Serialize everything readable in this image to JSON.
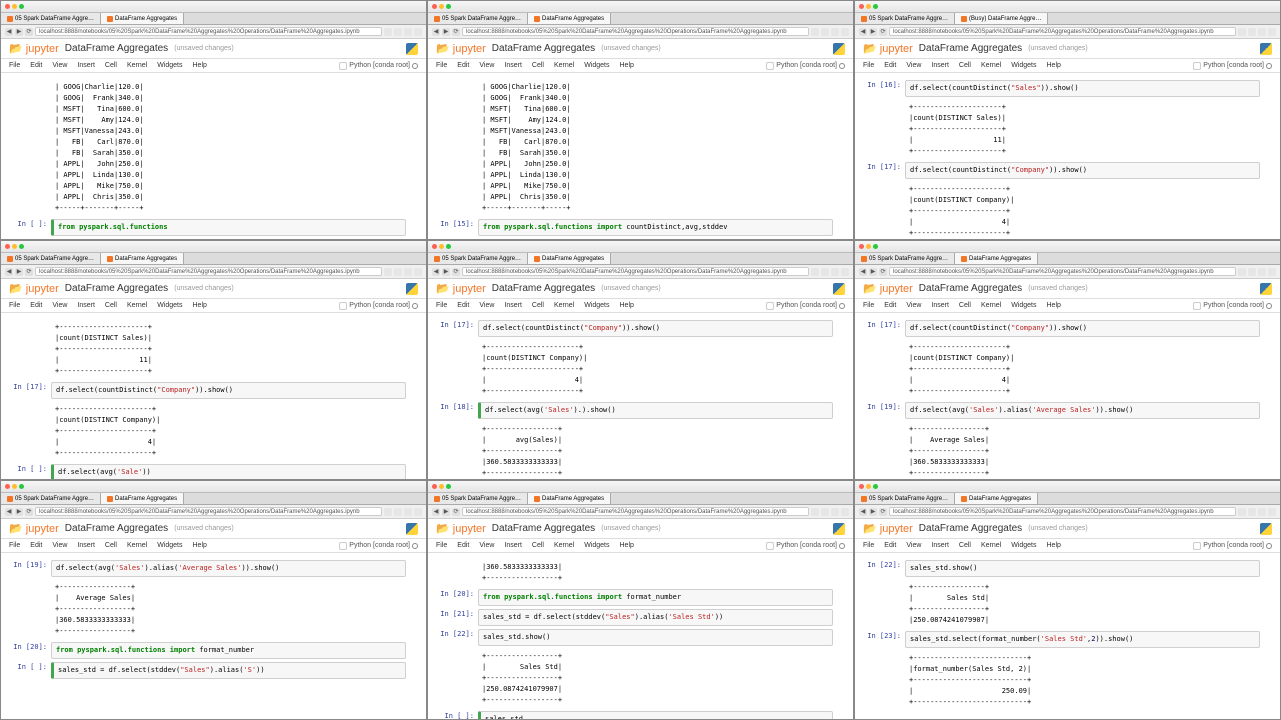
{
  "tabs": {
    "t1": "05 Spark DataFrame Aggre…",
    "t2": "DataFrame Aggregates",
    "t2busy": "(Busy) DataFrame Aggre…"
  },
  "url": "localhost:8888/notebooks/05%20Spark%20DataFrame%20Aggregates%20Operations/DataFrame%20Aggregates.ipynb",
  "logo_a": "jupyter",
  "nb_title": "DataFrame Aggregates",
  "unsaved": "(unsaved changes)",
  "menu": {
    "file": "File",
    "edit": "Edit",
    "view": "View",
    "insert": "Insert",
    "cell": "Cell",
    "kernel": "Kernel",
    "widgets": "Widgets",
    "help": "Help"
  },
  "kernel": "Python [conda root]",
  "outputs": {
    "df_show": "| GOOG|Charlie|120.0|\n| GOOG|  Frank|340.0|\n| MSFT|   Tina|600.0|\n| MSFT|    Amy|124.0|\n| MSFT|Vanessa|243.0|\n|   FB|   Carl|870.0|\n|   FB|  Sarah|350.0|\n| APPL|   John|250.0|\n| APPL|  Linda|130.0|\n| APPL|   Mike|750.0|\n| APPL|  Chris|350.0|\n+-----+-------+-----+",
    "distinct_sales": "+---------------------+\n|count(DISTINCT Sales)|\n+---------------------+\n|                   11|\n+---------------------+",
    "distinct_company": "+----------------------+\n|count(DISTINCT Company)|\n+----------------------+\n|                     4|\n+----------------------+",
    "avg_sales": "+-----------------+\n|       avg(Sales)|\n+-----------------+\n|360.5833333333333|\n+-----------------+",
    "avg_sales_alias": "+-----------------+\n|    Average Sales|\n+-----------------+\n|360.5833333333333|\n+-----------------+",
    "avg_sales_alias_tail": "|360.5833333333333|\n+-----------------+",
    "sales_std": "+-----------------+\n|        Sales Std|\n+-----------------+\n|250.0874241079907|\n+-----------------+",
    "sales_std_head": "+-----------------+\n|        Sales Std|\n+-----------------+\n|250.0874241079907|",
    "fmt_num": "+---------------------------+\n|format_number(Sales Std, 2)|\n+---------------------------+\n|                     250.09|\n+---------------------------+"
  },
  "code": {
    "from_funcs_partial": "from pyspark.sql.functions",
    "from_funcs": "from pyspark.sql.functions",
    "import_kw": "import",
    "import_suffix": " countDistinct,avg,stddev",
    "df_select_partial": "df.select",
    "cd_sales": "df.select(countDistinct(",
    "cd_sales_str": "\"Sales\"",
    "cd_sales_end": ")).show()",
    "cd_company": "df.select(countDistinct(",
    "cd_company_str": "\"Company\"",
    "cd_company_end": ")).show()",
    "avg_sale_p": "df.select(avg(",
    "avg_sale_str": "'Sale'",
    "avg_sale_end": "))",
    "avg_sales_p": "df.select(avg(",
    "avg_sales_str": "'Sales'",
    "avg_sales_end": ").).show()",
    "avg_alias": "df.select(avg(",
    "avg_alias_s1": "'Sales'",
    "avg_alias_mid": ").alias(",
    "avg_alias_s2": "'Average Sales'",
    "avg_alias_end": ")).show()",
    "from_fmt": "from pyspark.sql.functions",
    "fmt_suffix": " format_number",
    "std_assign": "sales_std = df.select(stddev(",
    "std_s1": "\"Sales\"",
    "std_mid": ").alias(",
    "std_partial": "'S'",
    "std_partial_end": "))",
    "std_s2": "'Sales Std'",
    "std_end": "))",
    "std_show": "sales_std.show()",
    "sales_std_txt": "sales_std",
    "fmt_select": "sales_std.select(format_number(",
    "fmt_s1": "'Sales Std'",
    "fmt_mid": ",",
    "fmt_n": "2",
    "fmt_end": ")).show()"
  },
  "prompts": {
    "blank": "In [ ]:",
    "p15": "In [15]:",
    "p16": "In [16]:",
    "p17": "In [17]:",
    "p18": "In [18]:",
    "p19": "In [19]:",
    "p20": "In [20]:",
    "p21": "In [21]:",
    "p22": "In [22]:",
    "p23": "In [23]:"
  }
}
